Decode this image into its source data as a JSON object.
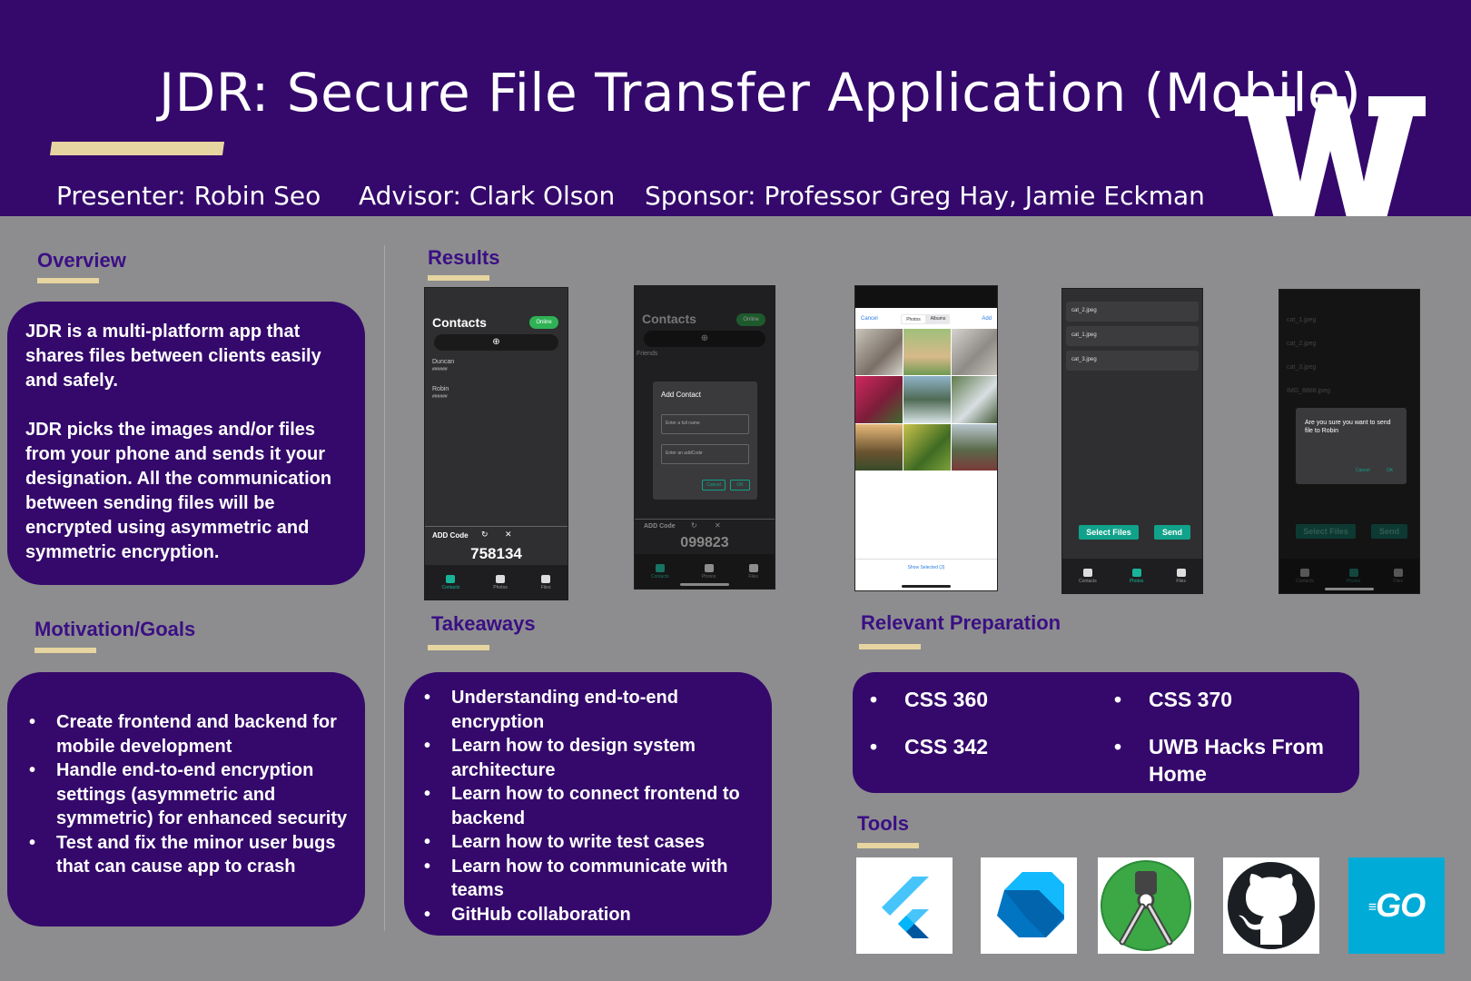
{
  "header": {
    "title": "JDR: Secure File Transfer Application (Mobile)",
    "presenter": "Presenter: Robin Seo",
    "advisor": "Advisor: Clark Olson",
    "sponsor": "Sponsor: Professor Greg Hay, Jamie Eckman",
    "logo_letter": "W"
  },
  "overview": {
    "heading": "Overview",
    "para1": "JDR is a multi-platform app that shares files between clients easily and safely.",
    "para2": "JDR picks the images and/or files from your phone and sends it your designation. All the communication between sending files will be encrypted using asymmetric and symmetric encryption."
  },
  "motivation": {
    "heading": "Motivation/Goals",
    "items": [
      "Create frontend and backend for mobile development",
      "Handle end-to-end encryption settings (asymmetric and symmetric) for enhanced security",
      "Test and fix the minor user bugs that can cause app to crash"
    ]
  },
  "results": {
    "heading": "Results"
  },
  "takeaways": {
    "heading": "Takeaways",
    "items": [
      "Understanding end-to-end encryption",
      "Learn how to design system architecture",
      "Learn how to connect frontend to backend",
      "Learn how to write test cases",
      "Learn how to communicate with teams",
      "GitHub collaboration"
    ]
  },
  "preparation": {
    "heading": "Relevant Preparation",
    "items": [
      "CSS 360",
      "CSS 370",
      "CSS 342",
      "UWB Hacks From Home"
    ]
  },
  "tools": {
    "heading": "Tools",
    "icons": [
      "flutter-icon",
      "dart-icon",
      "android-studio-icon",
      "github-icon",
      "go-icon"
    ],
    "go_label": "GO"
  },
  "phones": {
    "p1": {
      "title": "Contacts",
      "badge": "Online",
      "contacts": [
        {
          "name": "Duncan",
          "code": "######"
        },
        {
          "name": "Robin",
          "code": "######"
        }
      ],
      "add_code_label": "ADD Code",
      "code": "758134",
      "tabs": [
        "Contacts",
        "Photos",
        "Files"
      ]
    },
    "p2": {
      "title": "Contacts",
      "badge": "Online",
      "subheading": "Friends",
      "dialog_title": "Add Contact",
      "name_placeholder": "Enter a full name",
      "code_placeholder": "Enter an addCode",
      "cancel": "Cancel",
      "ok": "OK",
      "add_code_label": "ADD Code",
      "code": "099823",
      "tabs": [
        "Contacts",
        "Photos",
        "Files"
      ]
    },
    "p3": {
      "cancel": "Cancel",
      "seg_photos": "Photos",
      "seg_albums": "Albums",
      "add": "Add",
      "show_selected": "Show Selected (3)"
    },
    "p4": {
      "files": [
        "cat_2.jpeg",
        "cat_1.jpeg",
        "cat_3.jpeg"
      ],
      "select_files": "Select Files",
      "send": "Send",
      "tabs": [
        "Contacts",
        "Photos",
        "Files"
      ]
    },
    "p5": {
      "files": [
        "cat_1.jpeg",
        "cat_2.jpeg",
        "cat_3.jpeg",
        "IMG_8888.jpeg"
      ],
      "confirm_text": "Are you sure you want to send file to Robin",
      "cancel": "Cancel",
      "ok": "OK",
      "select_files": "Select Files",
      "send": "Send",
      "tabs": [
        "Contacts",
        "Photos",
        "Files"
      ]
    }
  },
  "colors": {
    "purple": "#34096b",
    "gold": "#e6d5a0",
    "teal": "#10a28a",
    "green": "#2fb255",
    "background": "#8d8d8f"
  }
}
